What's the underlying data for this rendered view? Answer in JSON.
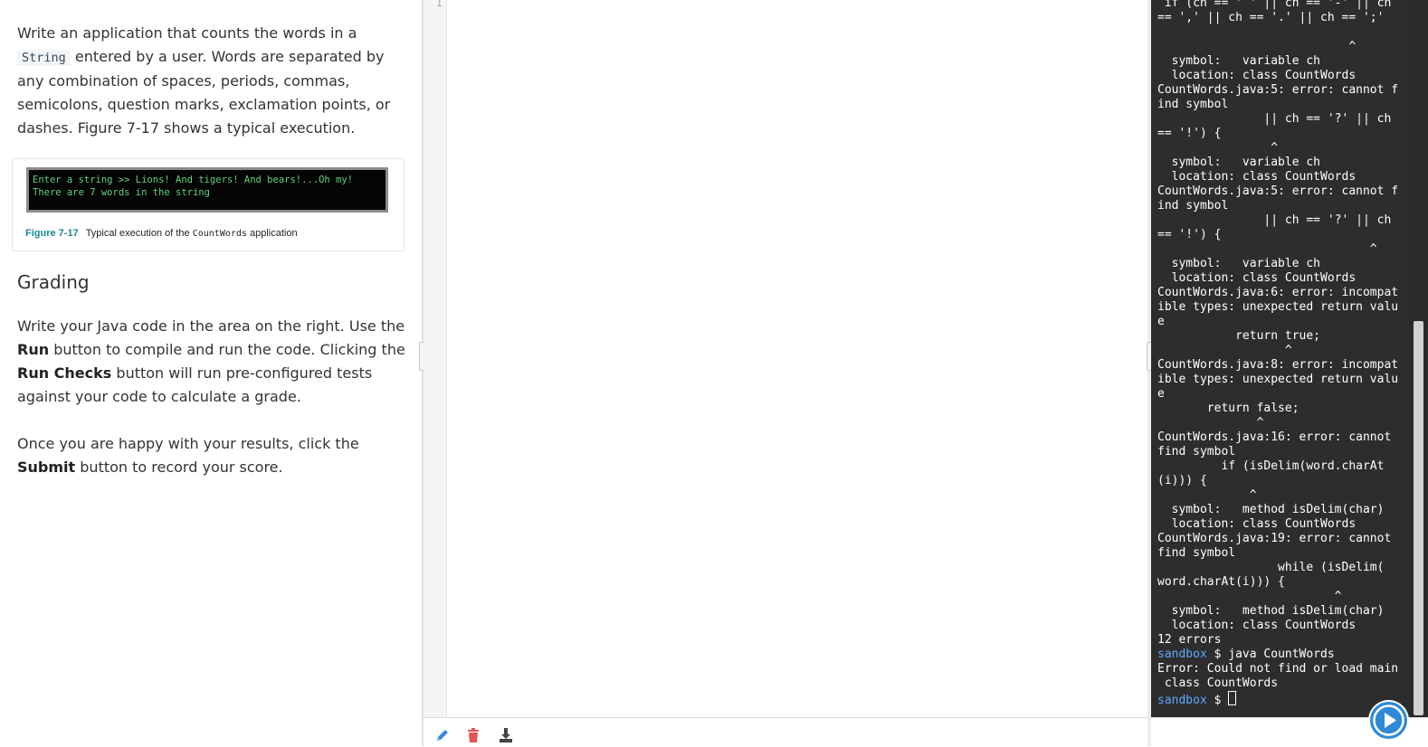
{
  "instructions": {
    "p1_before": "Write an application that counts the words in a",
    "p1_code": "String",
    "p1_after": "entered by a user. Words are separated by any combination of spaces, periods, commas, semicolons, question marks, exclamation points, or dashes. Figure 7-17 shows a typical execution.",
    "figure": {
      "terminal_lines": [
        "Enter a string >> Lions! And tigers! And bears!...Oh my!",
        "There are 7 words in the string"
      ],
      "label": "Figure 7-17",
      "caption_before": "Typical execution of the",
      "caption_code": "CountWords",
      "caption_after": "application"
    },
    "grading_heading": "Grading",
    "p2_before": "Write your Java code in the area on the right. Use the",
    "p2_bold1": "Run",
    "p2_mid1": "button to compile and run the code. Clicking the",
    "p2_bold2": "Run Checks",
    "p2_after": "button will run pre-configured tests against your code to calculate a grade.",
    "p3_before": "Once you are happy with your results, click the",
    "p3_bold": "Submit",
    "p3_after": "button to record your score."
  },
  "editor": {
    "line_number": "1",
    "toolbar_icons": [
      "pencil-icon",
      "trash-icon",
      "download-icon"
    ]
  },
  "terminal": {
    "lines": [
      " if (ch == ' ' || ch == '-' || ch",
      "== ',' || ch == '.' || ch == ';'",
      "",
      "                           ^",
      "  symbol:   variable ch",
      "  location: class CountWords",
      "CountWords.java:5: error: cannot f",
      "ind symbol",
      "               || ch == '?' || ch",
      "== '!') {",
      "                ^",
      "  symbol:   variable ch",
      "  location: class CountWords",
      "CountWords.java:5: error: cannot f",
      "ind symbol",
      "               || ch == '?' || ch",
      "== '!') {",
      "                              ^",
      "  symbol:   variable ch",
      "  location: class CountWords",
      "CountWords.java:6: error: incompat",
      "ible types: unexpected return valu",
      "e",
      "           return true;",
      "                  ^",
      "CountWords.java:8: error: incompat",
      "ible types: unexpected return valu",
      "e",
      "       return false;",
      "              ^",
      "CountWords.java:16: error: cannot",
      "find symbol",
      "         if (isDelim(word.charAt",
      "(i))) {",
      "             ^",
      "  symbol:   method isDelim(char)",
      "  location: class CountWords",
      "CountWords.java:19: error: cannot",
      "find symbol",
      "                 while (isDelim(",
      "word.charAt(i))) {",
      "                         ^",
      "  symbol:   method isDelim(char)",
      "  location: class CountWords",
      "12 errors"
    ],
    "prompt": "sandbox",
    "command": " $ java CountWords",
    "output_lines": [
      "Error: Could not find or load main",
      " class CountWords"
    ],
    "prompt_end": " $ "
  },
  "run_button": {
    "icon": "play-icon",
    "color": "#2d8ad6"
  }
}
